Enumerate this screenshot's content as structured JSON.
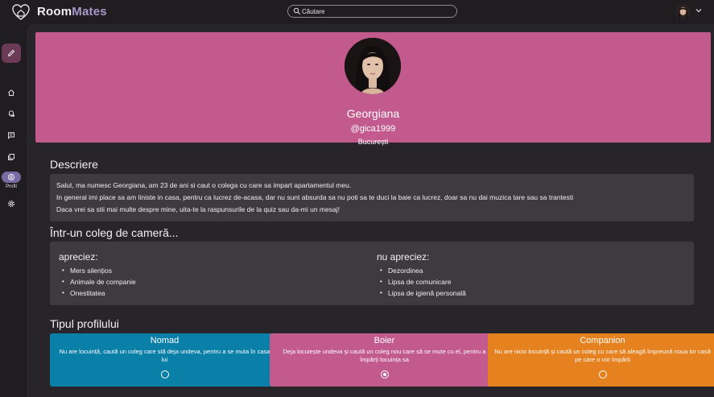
{
  "app": {
    "brand_part1": "Room",
    "brand_part2": "Mates"
  },
  "search": {
    "placeholder": "Căutare"
  },
  "rail": {
    "items": [
      {
        "icon": "home-icon"
      },
      {
        "icon": "notification-bell-icon"
      },
      {
        "icon": "chat-icon"
      },
      {
        "icon": "library-icon"
      },
      {
        "icon": "profile-icon",
        "label": "Profil",
        "active": true
      },
      {
        "icon": "settings-gear-icon"
      }
    ]
  },
  "profile": {
    "name": "Georgiana",
    "handle": "@gica1999",
    "city": "București"
  },
  "description": {
    "title": "Descriere",
    "lines": [
      "Salut, ma numesc Georgiana, am 23 de ani si caut o colega cu care sa impart apartamentul meu.",
      "In general imi place sa am liniste in casa, pentru ca lucrez de-acasa, dar nu sunt absurda sa nu poti sa te duci la baie ca lucrez, doar sa nu dai muzica tare sau sa trantesti",
      "Daca vrei sa stii mai multe despre mine, uita-te la raspunsurile de la quiz sau da-mi un mesaj!"
    ]
  },
  "roommate": {
    "title": "Într-un coleg de cameră...",
    "likes_title": "apreciez:",
    "likes": [
      "Mers silențios",
      "Animale de companie",
      "Onestitatea"
    ],
    "dislikes_title": "nu apreciez:",
    "dislikes": [
      "Dezordinea",
      "Lipsa de comunicare",
      "Lipsa de igienă personală"
    ]
  },
  "profile_type": {
    "title": "Tipul profilului",
    "options": [
      {
        "name": "Nomad",
        "desc": "Nu are locuință, caută un coleg care stă deja undeva, pentru a se muta în casa lui",
        "color": "#0a7fa8",
        "selected": false
      },
      {
        "name": "Boier",
        "desc": "Deja locuiește undeva și caută un coleg nou care să se mute cu el, pentru a împărți locuința sa",
        "color": "#c35a8e",
        "selected": true
      },
      {
        "name": "Companion",
        "desc": "Nu are nicio locuință și caută un coleg cu care să aleagă împreună noua lor casă pe care o vor împărți",
        "color": "#e5811f",
        "selected": false
      }
    ]
  },
  "colors": {
    "accent_pink": "#c35a8e",
    "accent_purple": "#7a6aa3",
    "background": "#1f1d20",
    "surface": "#3d3b40"
  }
}
